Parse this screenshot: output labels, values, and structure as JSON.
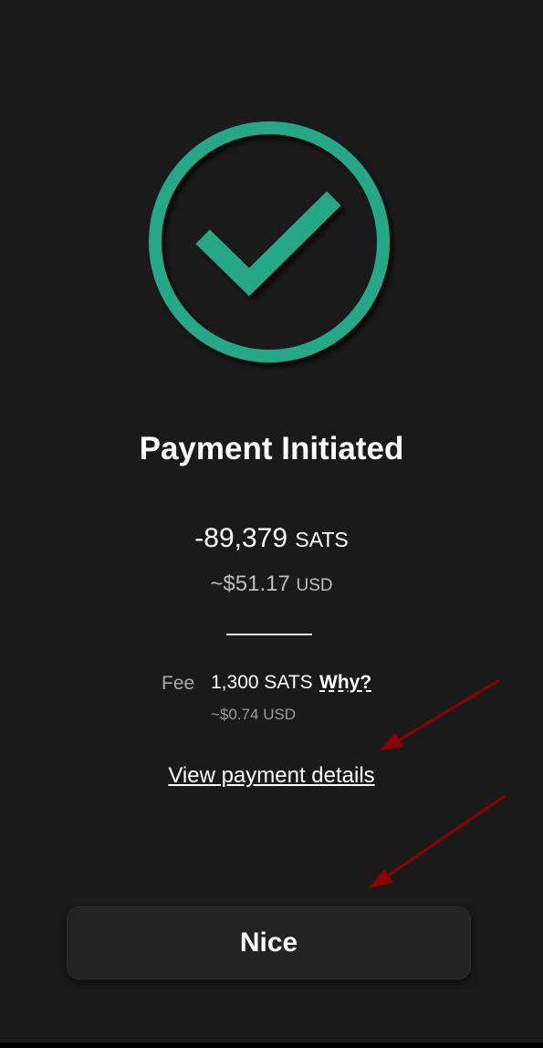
{
  "screen": {
    "title": "Payment Initiated",
    "status_icon": "check-circle-icon",
    "accent_color": "#26a785"
  },
  "amount": {
    "value": "-89,379",
    "unit": "SATS",
    "usd_value": "~$51.17",
    "usd_unit": "USD"
  },
  "fee": {
    "label": "Fee",
    "value": "1,300 SATS",
    "why_label": "Why?",
    "usd": "~$0.74 USD"
  },
  "links": {
    "view_details": "View payment details"
  },
  "buttons": {
    "nice": "Nice"
  },
  "annotations": {
    "arrow_color": "#8b0000"
  }
}
